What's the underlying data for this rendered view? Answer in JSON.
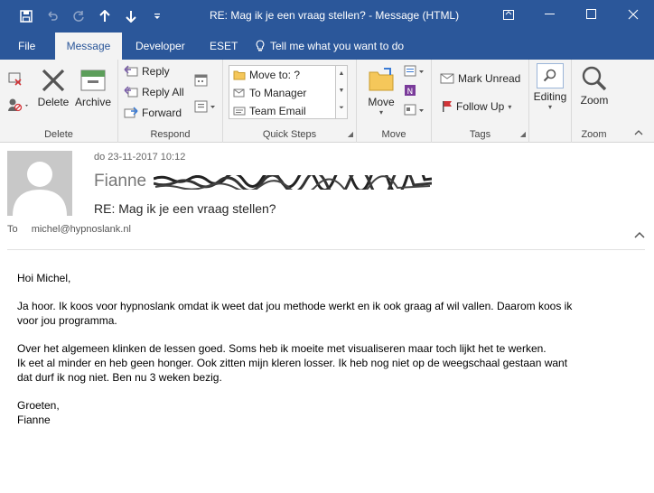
{
  "window": {
    "title": "RE: Mag ik je een vraag stellen?  -  Message (HTML)"
  },
  "tabs": [
    {
      "label": "File"
    },
    {
      "label": "Message"
    },
    {
      "label": "Developer"
    },
    {
      "label": "ESET"
    }
  ],
  "tell_me": "Tell me what you want to do",
  "ribbon": {
    "delete_group": {
      "label": "Delete",
      "delete": "Delete",
      "archive": "Archive"
    },
    "respond_group": {
      "label": "Respond",
      "reply": "Reply",
      "reply_all": "Reply All",
      "forward": "Forward"
    },
    "quick_steps_group": {
      "label": "Quick Steps",
      "items": [
        "Move to: ?",
        "To Manager",
        "Team Email"
      ]
    },
    "move_group": {
      "label": "Move",
      "move": "Move"
    },
    "tags_group": {
      "label": "Tags",
      "mark_unread": "Mark Unread",
      "follow_up": "Follow Up"
    },
    "editing_group": {
      "label": "",
      "editing": "Editing"
    },
    "zoom_group": {
      "label": "Zoom",
      "zoom": "Zoom"
    }
  },
  "message": {
    "date": "do 23-11-2017 10:12",
    "sender": "Fianne",
    "subject": "RE: Mag ik je een vraag stellen?",
    "to_label": "To",
    "to_address": "michel@hypnoslank.nl",
    "body": {
      "greeting": "Hoi Michel,",
      "p1_l1": "Ja hoor. Ik koos voor hypnoslank omdat ik weet dat jou methode werkt en ik ook graag af wil vallen. Daarom koos ik",
      "p1_l2": "voor jou programma.",
      "p2_l1": "Over het algemeen klinken de lessen goed. Soms heb ik moeite met visualiseren maar toch lijkt het te werken.",
      "p2_l2": "Ik eet al minder en heb geen honger. Ook zitten mijn kleren losser. Ik heb nog niet op de weegschaal gestaan want",
      "p2_l3": "dat durf ik nog niet. Ben nu 3 weken bezig.",
      "closing": "Groeten,",
      "signature": "Fianne"
    }
  },
  "colors": {
    "accent": "#2b579a",
    "ribbon_bg": "#f3f3f3"
  }
}
